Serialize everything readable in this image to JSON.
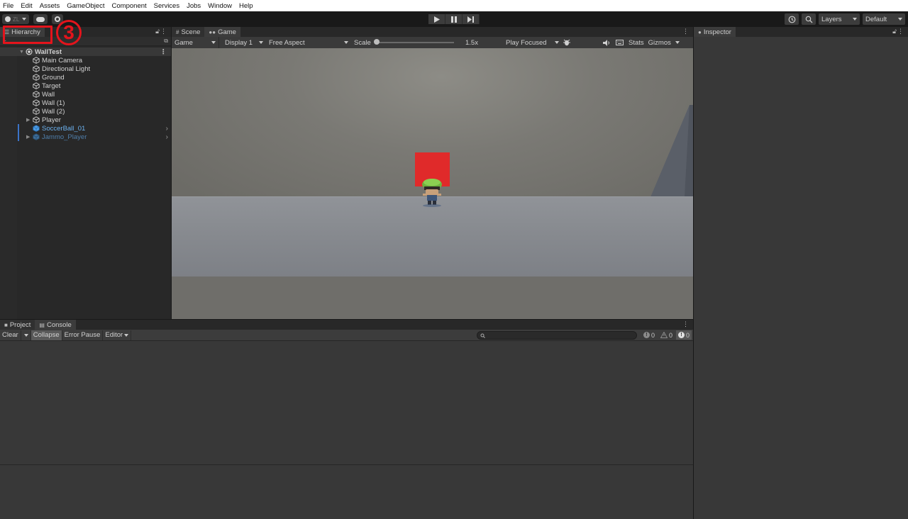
{
  "menubar": {
    "items": [
      "File",
      "Edit",
      "Assets",
      "GameObject",
      "Component",
      "Services",
      "Jobs",
      "Window",
      "Help"
    ]
  },
  "toolbar": {
    "account_label": "ZL",
    "layers_label": "Layers",
    "layout_label": "Default",
    "play_icons": [
      "play-icon",
      "pause-icon",
      "step-icon"
    ]
  },
  "hierarchy": {
    "tab_label": "Hierarchy",
    "scene_name": "WallTest",
    "items": [
      {
        "label": "Main Camera",
        "type": "gameobject"
      },
      {
        "label": "Directional Light",
        "type": "gameobject"
      },
      {
        "label": "Ground",
        "type": "gameobject"
      },
      {
        "label": "Target",
        "type": "gameobject"
      },
      {
        "label": "Wall",
        "type": "gameobject"
      },
      {
        "label": "Wall (1)",
        "type": "gameobject"
      },
      {
        "label": "Wall (2)",
        "type": "gameobject"
      },
      {
        "label": "Player",
        "type": "gameobject-collapsed"
      },
      {
        "label": "SoccerBall_01",
        "type": "prefab"
      },
      {
        "label": "Jammo_Player",
        "type": "prefab-disabled"
      }
    ]
  },
  "annotation": {
    "step_number": "3",
    "color": "#e4141c"
  },
  "gameview": {
    "tabs": [
      "Scene",
      "Game"
    ],
    "active_tab": "Game",
    "mode_select": "Game",
    "display_select": "Display 1",
    "aspect_select": "Free Aspect",
    "scale_label": "Scale",
    "scale_value": "1.5x",
    "play_focus_select": "Play Focused",
    "stats_label": "Stats",
    "gizmos_label": "Gizmos",
    "colors": {
      "target": "#e02a2a",
      "floor": "#888b90",
      "sky": "#7a7974"
    }
  },
  "inspector": {
    "tab_label": "Inspector"
  },
  "console": {
    "tabs": [
      "Project",
      "Console"
    ],
    "active_tab": "Console",
    "clear_label": "Clear",
    "collapse_label": "Collapse",
    "error_pause_label": "Error Pause",
    "editor_label": "Editor",
    "log_count": "0",
    "warning_count": "0",
    "error_count": "0"
  }
}
